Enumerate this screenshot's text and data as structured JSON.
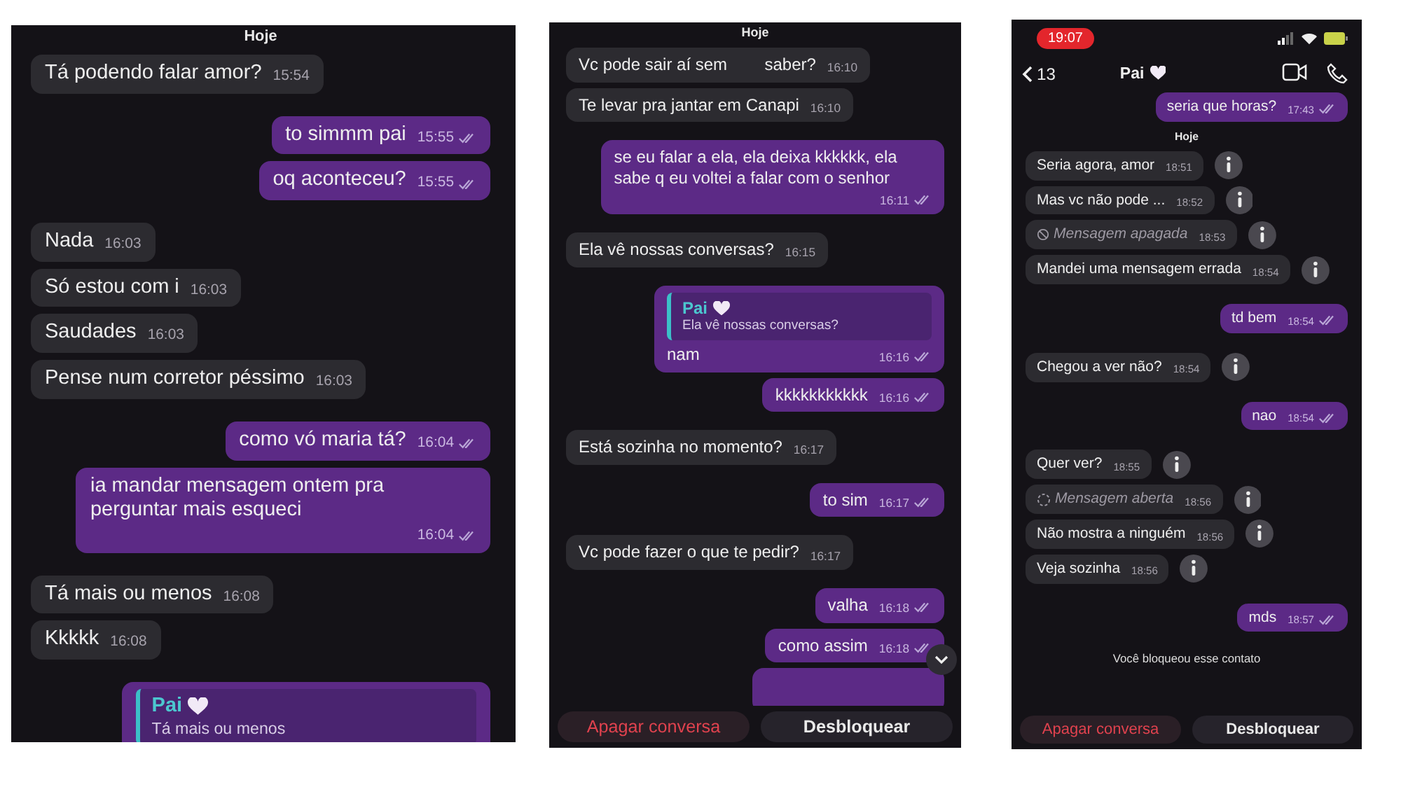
{
  "panels": [
    {
      "messages": [
        {
          "kind": "date",
          "text": "Hoje"
        },
        {
          "kind": "text",
          "outgoing": false,
          "text": "Tá podendo falar amor?",
          "time": "15:54"
        },
        {
          "kind": "text",
          "outgoing": true,
          "text": "to simmm pai",
          "time": "15:55"
        },
        {
          "kind": "text",
          "outgoing": true,
          "text": "oq aconteceu?",
          "time": "15:55"
        },
        {
          "kind": "text",
          "outgoing": false,
          "text": "Nada",
          "time": "16:03"
        },
        {
          "kind": "text",
          "outgoing": false,
          "text": "Só estou com i",
          "time": "16:03"
        },
        {
          "kind": "text",
          "outgoing": false,
          "text": "Saudades",
          "time": "16:03"
        },
        {
          "kind": "text",
          "outgoing": false,
          "text": "Pense num corretor péssimo",
          "time": "16:03"
        },
        {
          "kind": "text",
          "outgoing": true,
          "text": "como vó maria tá?",
          "time": "16:04"
        },
        {
          "kind": "text",
          "outgoing": true,
          "text": "ia mandar mensagem ontem pra perguntar mais esqueci",
          "time": "16:04"
        },
        {
          "kind": "text",
          "outgoing": false,
          "text": "Tá mais ou menos",
          "time": "16:08"
        },
        {
          "kind": "text",
          "outgoing": false,
          "text": "Kkkkk",
          "time": "16:08"
        },
        {
          "kind": "reply",
          "outgoing": true,
          "quote_name": "Pai",
          "quote_text": "Tá mais ou menos"
        }
      ]
    },
    {
      "messages": [
        {
          "kind": "date",
          "text": "Hoje"
        },
        {
          "kind": "text",
          "outgoing": false,
          "text": "Vc pode sair aí sem        saber?",
          "time": "16:10"
        },
        {
          "kind": "text",
          "outgoing": false,
          "text": "Te levar pra jantar em Canapi",
          "time": "16:10"
        },
        {
          "kind": "text",
          "outgoing": true,
          "text": "se eu falar a ela, ela deixa kkkkkk, ela sabe q eu voltei a falar com o senhor",
          "time": "16:11"
        },
        {
          "kind": "text",
          "outgoing": false,
          "text": "Ela vê nossas conversas?",
          "time": "16:15"
        },
        {
          "kind": "reply",
          "outgoing": true,
          "quote_name": "Pai",
          "quote_text": "Ela vê nossas conversas?",
          "text": "nam",
          "time": "16:16"
        },
        {
          "kind": "text",
          "outgoing": true,
          "text": "kkkkkkkkkkk",
          "time": "16:16"
        },
        {
          "kind": "text",
          "outgoing": false,
          "text": "Está sozinha no momento?",
          "time": "16:17"
        },
        {
          "kind": "text",
          "outgoing": true,
          "text": "to sim",
          "time": "16:17"
        },
        {
          "kind": "text",
          "outgoing": false,
          "text": "Vc pode fazer o que te pedir?",
          "time": "16:17"
        },
        {
          "kind": "text",
          "outgoing": true,
          "text": "valha",
          "time": "16:18"
        },
        {
          "kind": "text",
          "outgoing": true,
          "text": "como assim",
          "time": "16:18"
        },
        {
          "kind": "hidden",
          "outgoing": true
        }
      ],
      "scroll_down_button": true,
      "actions": [
        {
          "label": "Apagar conversa",
          "kind": "danger"
        },
        {
          "label": "Desbloquear",
          "kind": "normal"
        }
      ]
    },
    {
      "status_bar": {
        "time": "19:07"
      },
      "header": {
        "back_count": "13",
        "title": "Pai"
      },
      "messages": [
        {
          "kind": "text",
          "outgoing": true,
          "text": "seria que horas?",
          "time": "17:43"
        },
        {
          "kind": "date",
          "text": "Hoje"
        },
        {
          "kind": "text",
          "outgoing": false,
          "text": "Seria agora, amor",
          "time": "18:51",
          "info": true
        },
        {
          "kind": "text",
          "outgoing": false,
          "text": "Mas vc não pode ...",
          "time": "18:52",
          "info": true
        },
        {
          "kind": "deleted",
          "outgoing": false,
          "text": "Mensagem apagada",
          "time": "18:53",
          "info": true
        },
        {
          "kind": "text",
          "outgoing": false,
          "text": "Mandei uma mensagem errada",
          "time": "18:54",
          "info": true
        },
        {
          "kind": "text",
          "outgoing": true,
          "text": "td bem",
          "time": "18:54"
        },
        {
          "kind": "text",
          "outgoing": false,
          "text": "Chegou a ver não?",
          "time": "18:54",
          "info": true
        },
        {
          "kind": "text",
          "outgoing": true,
          "text": "nao",
          "time": "18:54"
        },
        {
          "kind": "text",
          "outgoing": false,
          "text": "Quer ver?",
          "time": "18:55",
          "info": true
        },
        {
          "kind": "opened",
          "outgoing": false,
          "text": "Mensagem aberta",
          "time": "18:56",
          "info": true
        },
        {
          "kind": "text",
          "outgoing": false,
          "text": "Não mostra a ninguém",
          "time": "18:56",
          "info": true
        },
        {
          "kind": "text",
          "outgoing": false,
          "text": "Veja sozinha",
          "time": "18:56",
          "info": true
        },
        {
          "kind": "text",
          "outgoing": true,
          "text": "mds",
          "time": "18:57"
        },
        {
          "kind": "notice",
          "text": "Você bloqueou esse contato"
        }
      ],
      "actions": [
        {
          "label": "Apagar conversa",
          "kind": "danger"
        },
        {
          "label": "Desbloquear",
          "kind": "normal"
        }
      ]
    }
  ]
}
